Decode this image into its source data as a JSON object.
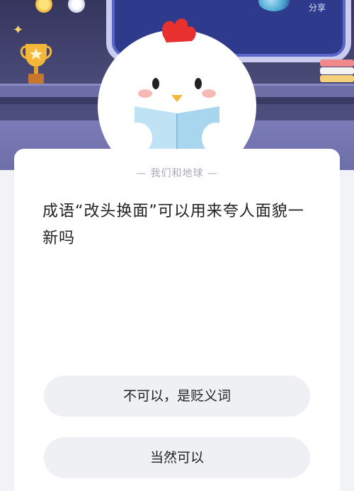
{
  "header": {
    "share_label": "分享"
  },
  "quiz": {
    "category": "我们和地球",
    "question": "成语“改头换面”可以用来夸人面貌一新吗",
    "options": [
      {
        "label": "不可以，是贬义词"
      },
      {
        "label": "当然可以"
      }
    ]
  },
  "icons": {
    "top_left": [
      "sun-icon",
      "gear-icon"
    ],
    "decor": [
      "sparkle-icon",
      "trophy-icon",
      "books-icon",
      "chicken-mascot"
    ]
  },
  "colors": {
    "scene_background": "#4a4b78",
    "card_background": "#ffffff",
    "option_background": "#eff0f4",
    "subtitle_text": "#a8aab4"
  }
}
